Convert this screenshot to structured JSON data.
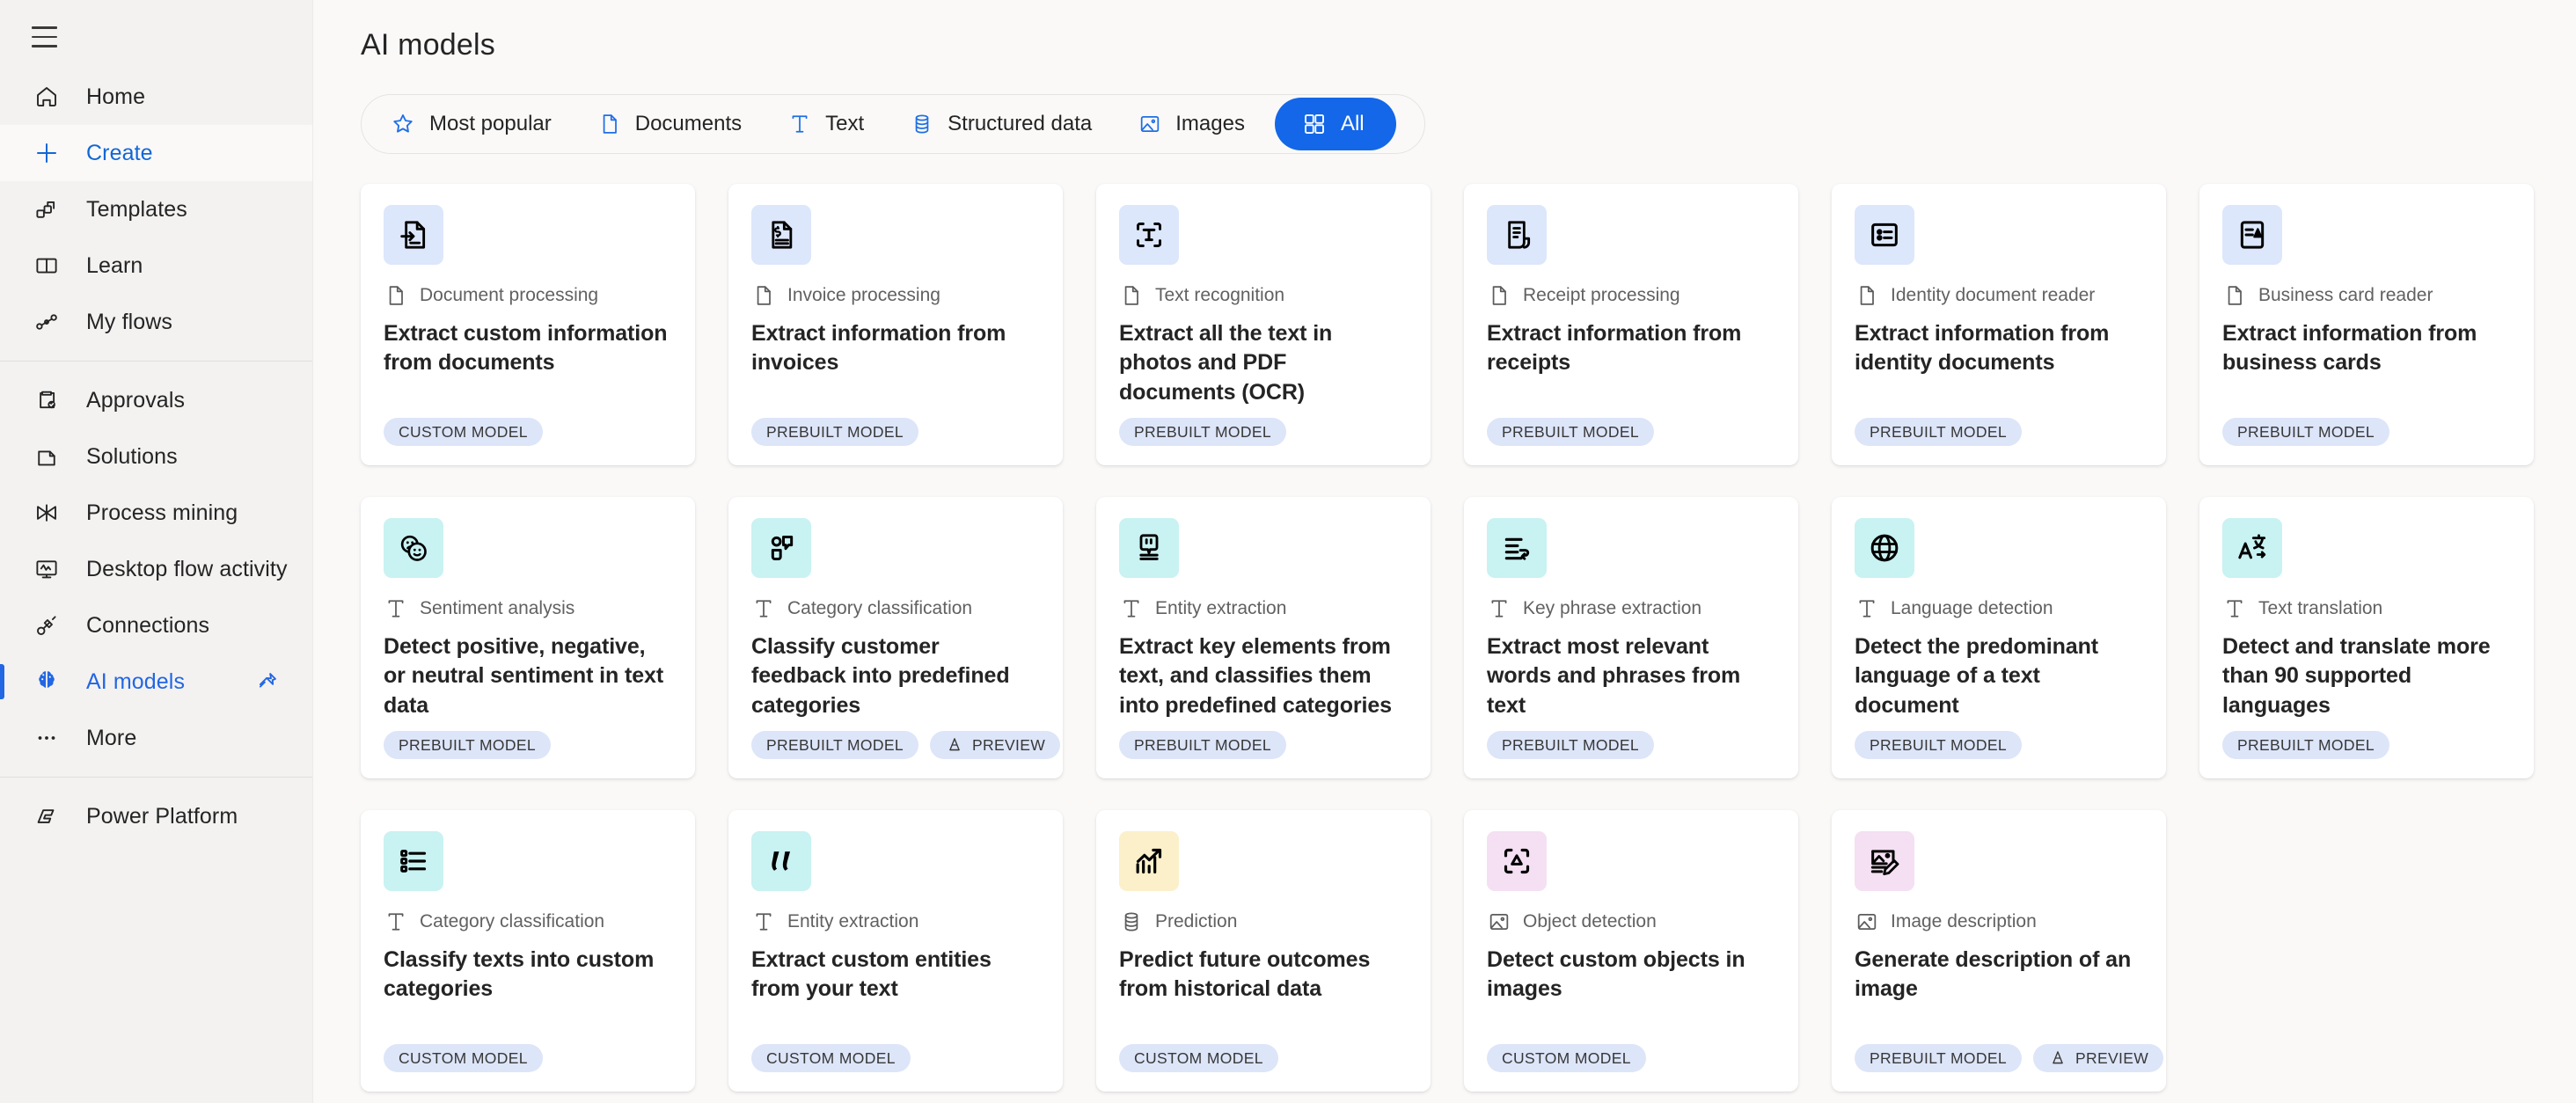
{
  "sidebar": {
    "menu_icon": "hamburger-icon",
    "groups": [
      {
        "items": [
          {
            "label": "Home",
            "icon": "home-icon",
            "state": "normal"
          },
          {
            "label": "Create",
            "icon": "plus-icon",
            "state": "hovered"
          },
          {
            "label": "Templates",
            "icon": "templates-icon",
            "state": "normal"
          },
          {
            "label": "Learn",
            "icon": "book-icon",
            "state": "normal"
          },
          {
            "label": "My flows",
            "icon": "flow-icon",
            "state": "normal"
          }
        ]
      },
      {
        "items": [
          {
            "label": "Approvals",
            "icon": "approvals-clipboard-icon",
            "state": "normal"
          },
          {
            "label": "Solutions",
            "icon": "solutions-icon",
            "state": "normal"
          },
          {
            "label": "Process mining",
            "icon": "process-mining-icon",
            "state": "normal"
          },
          {
            "label": "Desktop flow activity",
            "icon": "desktop-monitor-icon",
            "state": "normal"
          },
          {
            "label": "Connections",
            "icon": "plug-icon",
            "state": "normal"
          },
          {
            "label": "AI models",
            "icon": "brain-icon",
            "state": "active",
            "pin": "pin-icon"
          },
          {
            "label": "More",
            "icon": "ellipsis-icon",
            "state": "normal"
          }
        ]
      },
      {
        "items": [
          {
            "label": "Power Platform",
            "icon": "power-platform-icon",
            "state": "normal"
          }
        ]
      }
    ]
  },
  "header": {
    "title": "AI models"
  },
  "filters": {
    "items": [
      {
        "label": "Most popular",
        "icon": "star-icon",
        "selected": false
      },
      {
        "label": "Documents",
        "icon": "document-icon",
        "selected": false
      },
      {
        "label": "Text",
        "icon": "text-t-icon",
        "selected": false
      },
      {
        "label": "Structured data",
        "icon": "database-icon",
        "selected": false
      },
      {
        "label": "Images",
        "icon": "image-icon",
        "selected": false
      },
      {
        "label": "All",
        "icon": "grid-icon",
        "selected": true
      }
    ],
    "accent_color": "#1367e8"
  },
  "cards": [
    {
      "category": "Document processing",
      "category_icon": "document-icon",
      "title": "Extract custom information from documents",
      "tags": [
        {
          "label": "CUSTOM MODEL"
        }
      ],
      "icon": "document-extract-icon",
      "icon_bg": "#dce7fb"
    },
    {
      "category": "Invoice processing",
      "category_icon": "document-icon",
      "title": "Extract information from invoices",
      "tags": [
        {
          "label": "PREBUILT MODEL"
        }
      ],
      "icon": "invoice-dollar-icon",
      "icon_bg": "#dce7fb"
    },
    {
      "category": "Text recognition",
      "category_icon": "document-icon",
      "title": "Extract all the text in photos and PDF documents (OCR)",
      "tags": [
        {
          "label": "PREBUILT MODEL"
        }
      ],
      "icon": "ocr-scan-text-icon",
      "icon_bg": "#dce7fb"
    },
    {
      "category": "Receipt processing",
      "category_icon": "document-icon",
      "title": "Extract information from receipts",
      "tags": [
        {
          "label": "PREBUILT MODEL"
        }
      ],
      "icon": "receipt-icon",
      "icon_bg": "#dce7fb"
    },
    {
      "category": "Identity document reader",
      "category_icon": "document-icon",
      "title": "Extract information from identity documents",
      "tags": [
        {
          "label": "PREBUILT MODEL"
        }
      ],
      "icon": "id-card-icon",
      "icon_bg": "#dce7fb"
    },
    {
      "category": "Business card reader",
      "category_icon": "document-icon",
      "title": "Extract information from business cards",
      "tags": [
        {
          "label": "PREBUILT MODEL"
        }
      ],
      "icon": "business-card-icon",
      "icon_bg": "#dce7fb"
    },
    {
      "category": "Sentiment analysis",
      "category_icon": "text-t-icon",
      "title": "Detect positive, negative, or neutral sentiment in text data",
      "tags": [
        {
          "label": "PREBUILT MODEL"
        }
      ],
      "icon": "sentiment-faces-icon",
      "icon_bg": "#c9f2f2"
    },
    {
      "category": "Category classification",
      "category_icon": "text-t-icon",
      "title": "Classify customer feedback into predefined categories",
      "tags": [
        {
          "label": "PREBUILT MODEL"
        },
        {
          "label": "PREVIEW",
          "icon": "preview-cone-icon"
        }
      ],
      "icon": "feedback-bubble-icon",
      "icon_bg": "#c9f2f2"
    },
    {
      "category": "Entity extraction",
      "category_icon": "text-t-icon",
      "title": "Extract key elements from text, and classifies them into predefined categories",
      "tags": [
        {
          "label": "PREBUILT MODEL"
        }
      ],
      "icon": "entity-quote-icon",
      "icon_bg": "#c9f2f2"
    },
    {
      "category": "Key phrase extraction",
      "category_icon": "text-t-icon",
      "title": "Extract most relevant words and phrases from text",
      "tags": [
        {
          "label": "PREBUILT MODEL"
        }
      ],
      "icon": "key-phrase-icon",
      "icon_bg": "#c9f2f2"
    },
    {
      "category": "Language detection",
      "category_icon": "text-t-icon",
      "title": "Detect the predominant language of a text document",
      "tags": [
        {
          "label": "PREBUILT MODEL"
        }
      ],
      "icon": "globe-icon",
      "icon_bg": "#c9f2f2"
    },
    {
      "category": "Text translation",
      "category_icon": "text-t-icon",
      "title": "Detect and translate more than 90 supported languages",
      "tags": [
        {
          "label": "PREBUILT MODEL"
        }
      ],
      "icon": "translate-icon",
      "icon_bg": "#c9f2f2"
    },
    {
      "category": "Category classification",
      "category_icon": "text-t-icon",
      "title": "Classify texts into custom categories",
      "tags": [
        {
          "label": "CUSTOM MODEL"
        }
      ],
      "icon": "bullet-list-icon",
      "icon_bg": "#c9f2f2"
    },
    {
      "category": "Entity extraction",
      "category_icon": "text-t-icon",
      "title": "Extract custom entities from your text",
      "tags": [
        {
          "label": "CUSTOM MODEL"
        }
      ],
      "icon": "quote-marks-icon",
      "icon_bg": "#c9f2f2"
    },
    {
      "category": "Prediction",
      "category_icon": "database-icon",
      "title": "Predict future outcomes from historical data",
      "tags": [
        {
          "label": "CUSTOM MODEL"
        }
      ],
      "icon": "trend-chart-icon",
      "icon_bg": "#fbf0ca"
    },
    {
      "category": "Object detection",
      "category_icon": "image-icon",
      "title": "Detect custom objects in images",
      "tags": [
        {
          "label": "CUSTOM MODEL"
        }
      ],
      "icon": "object-scan-icon",
      "icon_bg": "#f4e0f2"
    },
    {
      "category": "Image description",
      "category_icon": "image-icon",
      "title": "Generate description of an image",
      "tags": [
        {
          "label": "PREBUILT MODEL"
        },
        {
          "label": "PREVIEW",
          "icon": "preview-cone-icon"
        }
      ],
      "icon": "image-edit-icon",
      "icon_bg": "#f4e0f2"
    }
  ]
}
